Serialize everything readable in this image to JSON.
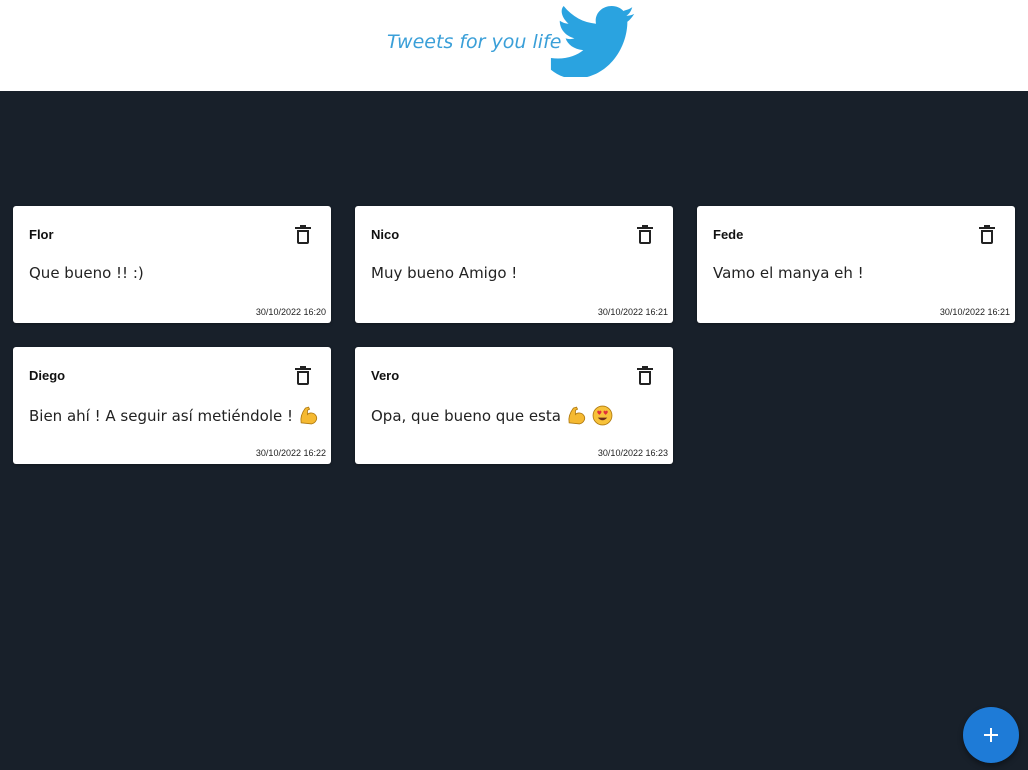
{
  "header": {
    "title": "Tweets for you life",
    "logo_icon": "twitter-bird-icon"
  },
  "colors": {
    "header_bg": "#ffffff",
    "page_bg": "#18202a",
    "brand_blue": "#2aa3e0",
    "fab_blue": "#1e7bd7"
  },
  "tweets": [
    {
      "author": "Flor",
      "text": "Que bueno !! :)",
      "date": "30/10/2022 16:20",
      "emojis": []
    },
    {
      "author": "Nico",
      "text": "Muy bueno Amigo !",
      "date": "30/10/2022 16:21",
      "emojis": []
    },
    {
      "author": "Fede",
      "text": "Vamo el manya eh !",
      "date": "30/10/2022 16:21",
      "emojis": []
    },
    {
      "author": "Diego",
      "text": "Bien ahí ! A seguir así metiéndole !",
      "date": "30/10/2022 16:22",
      "emojis": [
        "flexed-biceps-emoji"
      ]
    },
    {
      "author": "Vero",
      "text": "Opa, que bueno que esta",
      "date": "30/10/2022 16:23",
      "emojis": [
        "flexed-biceps-emoji",
        "heart-eyes-emoji"
      ]
    }
  ],
  "actions": {
    "delete_icon": "trash-icon",
    "add_icon": "plus-icon"
  }
}
